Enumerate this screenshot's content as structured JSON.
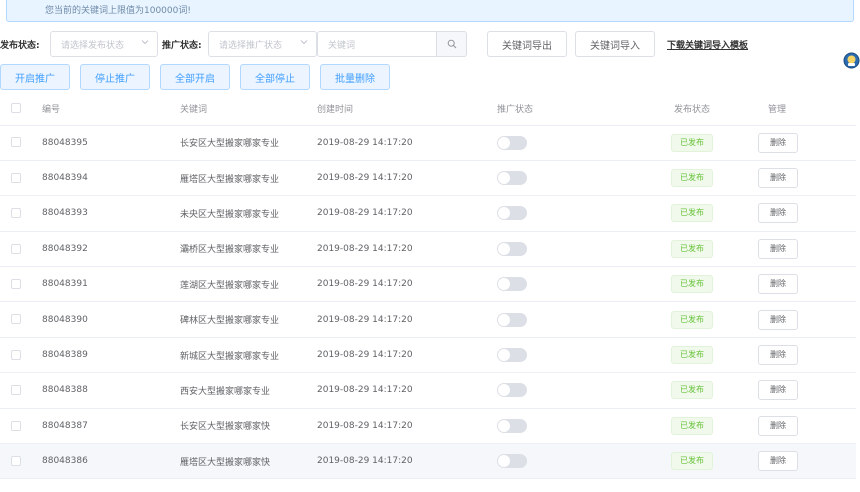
{
  "notice": "您当前的关键词上限值为100000词!",
  "filters": {
    "publish_label": "发布状态:",
    "publish_placeholder": "请选择发布状态",
    "promo_label": "推广状态:",
    "promo_placeholder": "请选择推广状态",
    "keyword_placeholder": "关键词",
    "export_label": "关键词导出",
    "import_label": "关键词导入",
    "download_link": "下载关键词导入模板"
  },
  "actions": {
    "start_promo": "开启推广",
    "stop_promo": "停止推广",
    "enable_all": "全部开启",
    "stop_all": "全部停止",
    "batch_delete": "批量删除"
  },
  "table": {
    "headers": {
      "id": "编号",
      "keyword": "关键词",
      "created": "创建时间",
      "promo": "推广状态",
      "publish": "发布状态",
      "manage": "管理"
    },
    "rows": [
      {
        "id": "88048395",
        "keyword": "长安区大型搬家哪家专业",
        "created": "2019-08-29 14:17:20",
        "promo_on": false,
        "status": "已发布",
        "action": "删除"
      },
      {
        "id": "88048394",
        "keyword": "雁塔区大型搬家哪家专业",
        "created": "2019-08-29 14:17:20",
        "promo_on": false,
        "status": "已发布",
        "action": "删除"
      },
      {
        "id": "88048393",
        "keyword": "未央区大型搬家哪家专业",
        "created": "2019-08-29 14:17:20",
        "promo_on": false,
        "status": "已发布",
        "action": "删除"
      },
      {
        "id": "88048392",
        "keyword": "灞桥区大型搬家哪家专业",
        "created": "2019-08-29 14:17:20",
        "promo_on": false,
        "status": "已发布",
        "action": "删除"
      },
      {
        "id": "88048391",
        "keyword": "莲湖区大型搬家哪家专业",
        "created": "2019-08-29 14:17:20",
        "promo_on": false,
        "status": "已发布",
        "action": "删除"
      },
      {
        "id": "88048390",
        "keyword": "碑林区大型搬家哪家专业",
        "created": "2019-08-29 14:17:20",
        "promo_on": false,
        "status": "已发布",
        "action": "删除"
      },
      {
        "id": "88048389",
        "keyword": "新城区大型搬家哪家专业",
        "created": "2019-08-29 14:17:20",
        "promo_on": false,
        "status": "已发布",
        "action": "删除"
      },
      {
        "id": "88048388",
        "keyword": "西安大型搬家哪家专业",
        "created": "2019-08-29 14:17:20",
        "promo_on": false,
        "status": "已发布",
        "action": "删除"
      },
      {
        "id": "88048387",
        "keyword": "长安区大型搬家哪家快",
        "created": "2019-08-29 14:17:20",
        "promo_on": false,
        "status": "已发布",
        "action": "删除"
      },
      {
        "id": "88048386",
        "keyword": "雁塔区大型搬家哪家快",
        "created": "2019-08-29 14:17:20",
        "promo_on": false,
        "status": "已发布",
        "action": "删除"
      }
    ]
  },
  "colors": {
    "primary": "#409eff",
    "success": "#67c23a",
    "notice_bg": "#e8f4ff"
  },
  "icons": {
    "select_arrow": "chevron-down-icon",
    "search": "search-icon",
    "floating": "customer-service-icon"
  }
}
